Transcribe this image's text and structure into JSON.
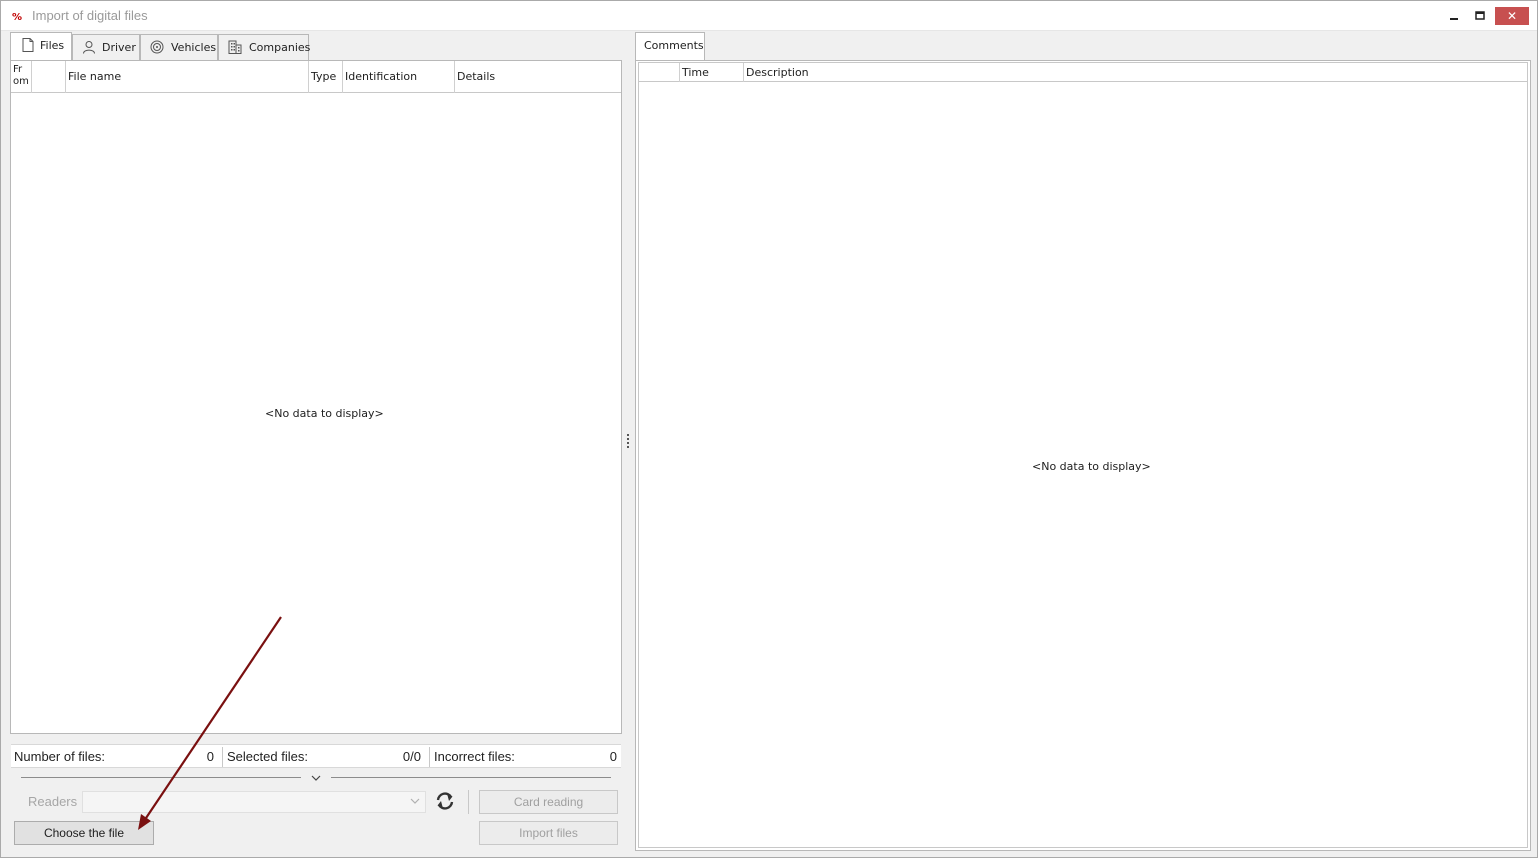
{
  "window": {
    "title": "Import of digital files",
    "minimize_glyph": "‒",
    "maximize_glyph": "■",
    "close_glyph": "✕"
  },
  "left_tabs": [
    {
      "label": "Files",
      "icon": "file-icon",
      "active": true
    },
    {
      "label": "Driver",
      "icon": "user-icon",
      "active": false
    },
    {
      "label": "Vehicles",
      "icon": "steering-wheel-icon",
      "active": false
    },
    {
      "label": "Companies",
      "icon": "building-icon",
      "active": false
    }
  ],
  "files_grid": {
    "columns": [
      "Fr\nom",
      "",
      "File name",
      "Type",
      "Identification",
      "Details"
    ],
    "empty_message": "<No data to display>"
  },
  "status": {
    "number_of_files_label": "Number of files:",
    "number_of_files_value": "0",
    "selected_files_label": "Selected files:",
    "selected_files_value": "0/0",
    "incorrect_files_label": "Incorrect files:",
    "incorrect_files_value": "0"
  },
  "readers": {
    "label": "Readers",
    "selected": ""
  },
  "buttons": {
    "card_reading": "Card reading",
    "choose_file": "Choose the file",
    "import_files": "Import files"
  },
  "right_tabs": [
    {
      "label": "Comments",
      "active": true
    }
  ],
  "comments_grid": {
    "columns": [
      "",
      "Time",
      "Description"
    ],
    "empty_message": "<No data to display>"
  },
  "colors": {
    "close_button": "#c75050",
    "annotation_arrow": "#7a1010",
    "border": "#b8b8b8"
  }
}
